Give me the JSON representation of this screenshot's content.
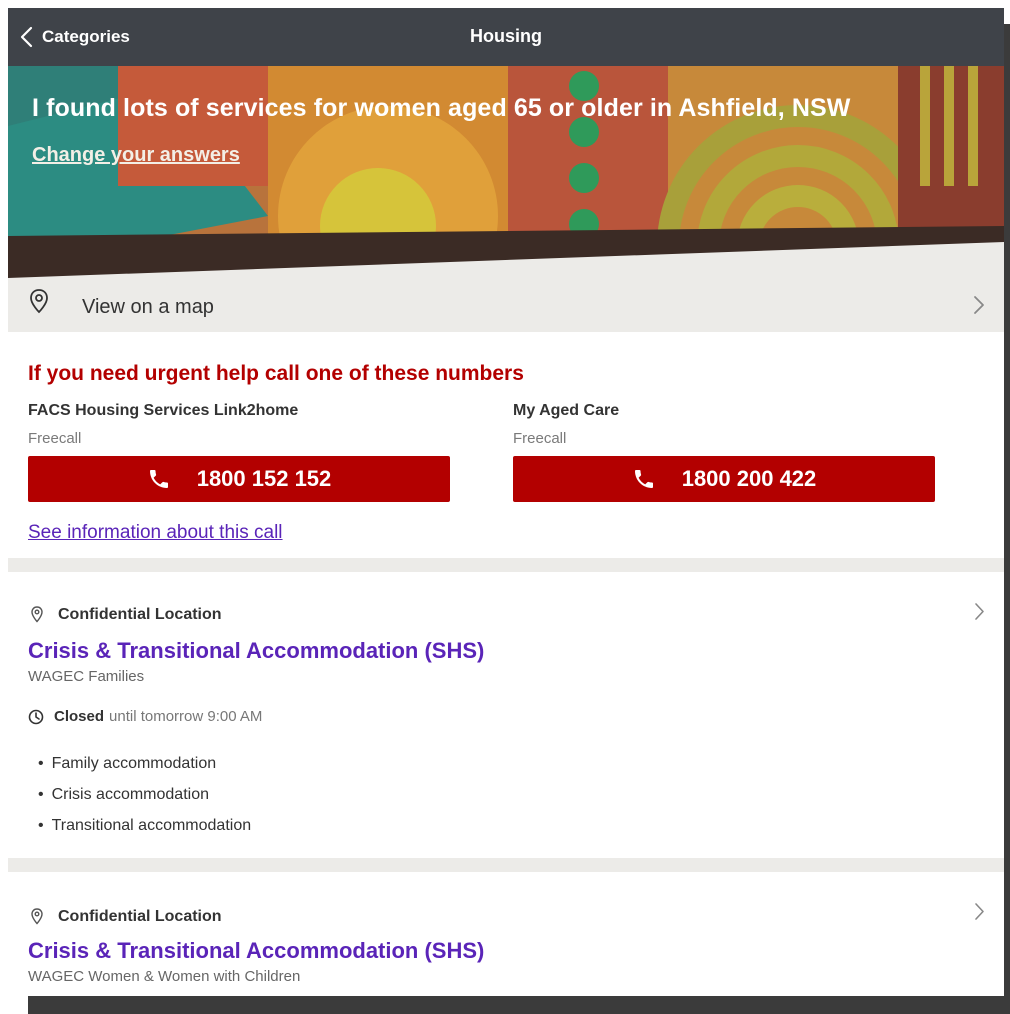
{
  "nav": {
    "back_label": "Categories",
    "title": "Housing"
  },
  "hero": {
    "headline": "I found lots of services for women aged 65 or older in Ashfield, NSW",
    "change_link": "Change your answers"
  },
  "map": {
    "label": "View on a map",
    "icon": "location-pin-icon"
  },
  "urgent": {
    "heading": "If you need urgent help call one of these numbers",
    "services": [
      {
        "name": "FACS Housing Services Link2home",
        "type": "Freecall",
        "number": "1800 152 152"
      },
      {
        "name": "My Aged Care",
        "type": "Freecall",
        "number": "1800 200 422"
      }
    ],
    "info_link": "See information about this call"
  },
  "results": [
    {
      "location": "Confidential Location",
      "title": "Crisis & Transitional Accommodation (SHS)",
      "org": "WAGEC Families",
      "status": "Closed",
      "status_detail": "until tomorrow 9:00 AM",
      "features": [
        "Family accommodation",
        "Crisis accommodation",
        "Transitional accommodation"
      ]
    },
    {
      "location": "Confidential Location",
      "title": "Crisis & Transitional Accommodation (SHS)",
      "org": "WAGEC Women & Women with Children"
    }
  ],
  "colors": {
    "navbar": "#3f4349",
    "urgent_red": "#b30000",
    "link_purple": "#5a24b8",
    "section_grey": "#ecebe8"
  }
}
